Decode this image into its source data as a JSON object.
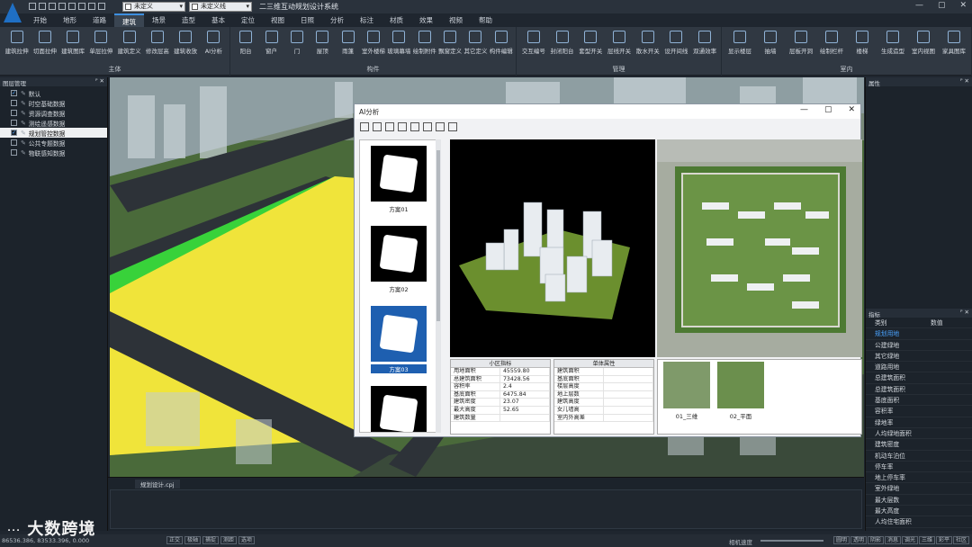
{
  "app_title": "二三维互动规划设计系统",
  "combo_left": "未定义",
  "combo_right": "未定义线",
  "menu": [
    "开始",
    "地形",
    "道路",
    "建筑",
    "场景",
    "造型",
    "基本",
    "定位",
    "视图",
    "日照",
    "分析",
    "标注",
    "材质",
    "效果",
    "视频",
    "帮助"
  ],
  "menu_active": 3,
  "ribbon_groups": [
    {
      "label": "主体",
      "buttons": [
        "建筑拉伸",
        "切面拉伸",
        "建筑图库",
        "单层拉伸",
        "建筑定义",
        "修改层高",
        "建筑收放",
        "AI分析"
      ]
    },
    {
      "label": "构件",
      "buttons": [
        "阳台",
        "窗户",
        "门",
        "屋顶",
        "雨蓬",
        "室外楼梯",
        "玻璃幕墙",
        "绘制附件",
        "飘窗定义",
        "其它定义",
        "构件编辑"
      ]
    },
    {
      "label": "管理",
      "buttons": [
        "交互编号",
        "封闭阳台",
        "套型开关",
        "层线开关",
        "散水开关",
        "设开间线",
        "双通效率"
      ]
    },
    {
      "label": "室内",
      "buttons": [
        "显示楼层",
        "抽墙",
        "层板开洞",
        "绘制栏杆",
        "楼梯",
        "生成造型",
        "室内视图",
        "家具图库"
      ]
    }
  ],
  "left_panel": {
    "title": "图层管理",
    "layers": [
      {
        "name": "默认",
        "checked": true
      },
      {
        "name": "时空基础数据",
        "checked": false
      },
      {
        "name": "资源调查数据",
        "checked": false
      },
      {
        "name": "测绘遥感数据",
        "checked": false
      },
      {
        "name": "规划管控数据",
        "checked": true
      },
      {
        "name": "公共专题数据",
        "checked": false
      },
      {
        "name": "物联感知数据",
        "checked": false
      }
    ]
  },
  "right_panel": {
    "top_title": "属性",
    "attr_title": "指标",
    "col1": "类别",
    "col2": "数值",
    "rows": [
      "规划用地",
      "公建绿地",
      "其它绿地",
      "道路用地",
      "总建筑面积",
      "总建筑面积",
      "基底面积",
      "容积率",
      "绿地率",
      "人均绿地面积",
      "建筑密度",
      "机动车泊位",
      "停车率",
      "地上停车率",
      "室外绿地",
      "最大层数",
      "最大高度",
      "人均住宅面积"
    ],
    "selected": 0
  },
  "dialog": {
    "title": "AI分析",
    "schemes": [
      "方案01",
      "方案02",
      "方案03",
      ""
    ],
    "selected_scheme": 2,
    "table1": {
      "title": "小区指标",
      "rows": [
        [
          "用地面积",
          "45559.80"
        ],
        [
          "总建筑面积",
          "73428.56"
        ],
        [
          "容积率",
          "2.4"
        ],
        [
          "基底面积",
          "6475.84"
        ],
        [
          "建筑密度",
          "23.07"
        ],
        [
          "最大高度",
          "52.65"
        ],
        [
          "建筑数量",
          ""
        ]
      ]
    },
    "table2": {
      "title": "单体属性",
      "rows": [
        "建筑面积",
        "基底面积",
        "楼层高度",
        "地上层数",
        "建筑高度",
        "女儿墙高",
        "室内外高差"
      ]
    },
    "views": [
      "01_三维",
      "02_平面"
    ]
  },
  "bottom": {
    "tab": "规划设计.cpj"
  },
  "status": {
    "coords": "86536.386, 83533.396, 0.000",
    "buttons_left": [
      "正交",
      "极轴",
      "捕捉",
      "测距",
      "选项"
    ],
    "camera": "相机速度",
    "buttons_right": [
      "圆明",
      "透明",
      "阴影",
      "消息",
      "调光",
      "三维",
      "彩平",
      "社区"
    ]
  },
  "watermark": "大数跨境"
}
